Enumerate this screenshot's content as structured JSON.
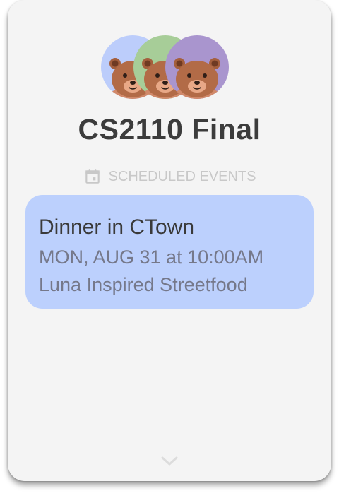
{
  "group": {
    "title": "CS2110 Final",
    "member_avatars": [
      {
        "icon": "bear-avatar-icon",
        "color": "#bccdfb"
      },
      {
        "icon": "bear-avatar-icon",
        "color": "#a7cd98"
      },
      {
        "icon": "bear-avatar-icon",
        "color": "#a995ce"
      }
    ]
  },
  "section": {
    "icon": "calendar-icon",
    "label": "SCHEDULED EVENTS"
  },
  "events": [
    {
      "title": "Dinner in CTown",
      "datetime": "MON, AUG 31 at 10:00AM",
      "location": "Luna Inspired Streetfood"
    }
  ],
  "footer": {
    "icon": "chevron-down-icon"
  },
  "colors": {
    "card_background": "#f4f4f4",
    "event_card": "#bcd0fd",
    "title_text": "#3c3c3c",
    "muted_text": "#c8c8c8"
  }
}
